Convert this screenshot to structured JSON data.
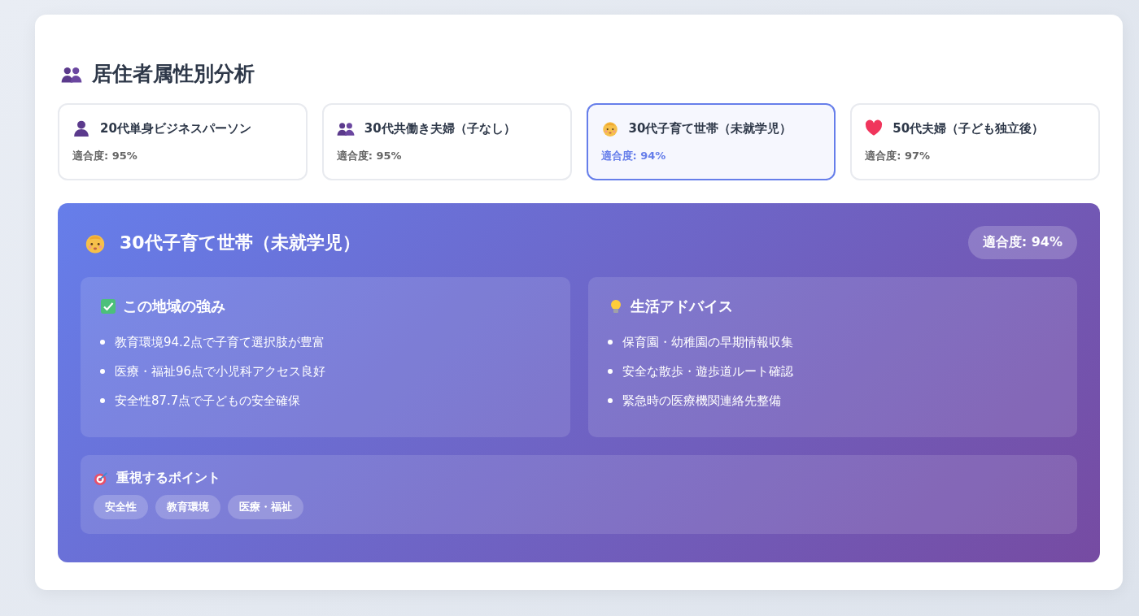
{
  "title": "居住者属性別分析",
  "profiles": [
    {
      "kind": "single",
      "name": "20代単身ビジネスパーソン",
      "score": "適合度: 95%",
      "selected": false
    },
    {
      "kind": "couple",
      "name": "30代共働き夫婦（子なし）",
      "score": "適合度: 95%",
      "selected": false
    },
    {
      "kind": "baby",
      "name": "30代子育て世帯（未就学児）",
      "score": "適合度: 94%",
      "selected": true
    },
    {
      "kind": "heart",
      "name": "50代夫婦（子ども独立後）",
      "score": "適合度: 97%",
      "selected": false
    }
  ],
  "detail": {
    "kind": "baby",
    "name": "30代子育て世帯（未就学児）",
    "badge": "適合度: 94%",
    "sections": [
      {
        "kind": "check",
        "title": "この地域の強み",
        "items": [
          "教育環境94.2点で子育て選択肢が豊富",
          "医療・福祉96点で小児科アクセス良好",
          "安全性87.7点で子どもの安全確保"
        ]
      },
      {
        "kind": "bulb",
        "title": "生活アドバイス",
        "items": [
          "保育園・幼稚園の早期情報収集",
          "安全な散歩・遊歩道ルート確認",
          "緊急時の医療機関連絡先整備"
        ]
      }
    ],
    "points": {
      "title": "重視するポイント",
      "tags": [
        "安全性",
        "教育環境",
        "医療・福祉"
      ]
    }
  }
}
